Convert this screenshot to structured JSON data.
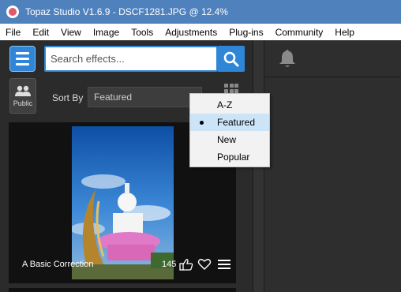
{
  "window": {
    "title": "Topaz Studio V1.6.9 - DSCF1281.JPG @ 12.4%"
  },
  "menubar": {
    "items": [
      "File",
      "Edit",
      "View",
      "Image",
      "Tools",
      "Adjustments",
      "Plug-ins",
      "Community",
      "Help"
    ]
  },
  "search": {
    "placeholder": "Search effects..."
  },
  "public_label": "Public",
  "sort": {
    "label": "Sort By",
    "selected": "Featured"
  },
  "dropdown": {
    "options": [
      "A-Z",
      "Featured",
      "New",
      "Popular"
    ],
    "selected": "Featured"
  },
  "card": {
    "title": "A Basic Correction",
    "likes": "145"
  },
  "icons": {
    "app": "topaz-logo-icon",
    "menu": "hamburger-icon",
    "search": "search-icon",
    "public": "users-icon",
    "grid": "grid-view-icon",
    "bell": "bell-icon",
    "like": "thumbs-up-icon",
    "favorite": "heart-icon",
    "more": "hamburger-icon"
  },
  "colors": {
    "titlebar": "#4f81bd",
    "accent": "#2f86d6",
    "selected_option": "#cce4f7"
  }
}
